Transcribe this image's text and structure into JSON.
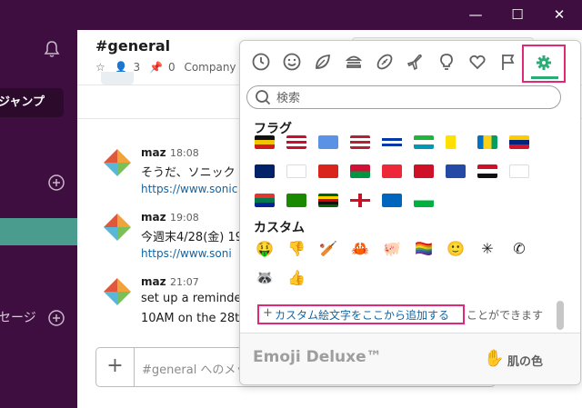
{
  "window": {
    "min_glyph": "—",
    "max_glyph": "☐",
    "close_glyph": "✕"
  },
  "sidebar": {
    "jump_label": "ジャンプ",
    "dm_label": "セージ",
    "icons": [
      "bell-icon",
      "add-channel-icon",
      "add-dm-icon"
    ]
  },
  "channel": {
    "name": "#general",
    "member_count": "3",
    "pin_count": "0",
    "topic_prefix": "Company"
  },
  "messages": [
    {
      "user": "maz",
      "time": "18:08",
      "text": "そうだ、ソニック",
      "link": "https://www.sonic"
    },
    {
      "user": "maz",
      "time": "19:08",
      "text": "今週末4/28(金) 19",
      "link": "https://www.soni"
    },
    {
      "user": "maz",
      "time": "21:07",
      "text": "set up a reminder",
      "text2": "10AM on the 28th"
    }
  ],
  "composer": {
    "plus": "+",
    "placeholder": "#general へのメッ"
  },
  "picker": {
    "tabs": [
      "recent",
      "people",
      "nature",
      "food",
      "activity",
      "travel",
      "objects",
      "symbols",
      "flags",
      "custom"
    ],
    "active_tab": "custom",
    "search_placeholder": "検索",
    "section_flags": "フラグ",
    "section_custom": "カスタム",
    "custom_emojis": [
      "🤑",
      "👎",
      "🏏",
      "🦀",
      "🐖",
      "🏳️‍🌈",
      "🙂",
      "✳",
      "✆",
      "🦝",
      "👍"
    ],
    "hint_plus": "+",
    "hint_link": "カスタム絵文字をここから追加する",
    "hint_rest": "ことができます",
    "preview_name": "Emoji Deluxe™",
    "skin_hand": "✋",
    "skin_label": "肌の色"
  },
  "colors": {
    "sidebar_bg": "#3f0e40",
    "active_channel": "#4a9c8f",
    "link": "#1264a3",
    "highlight_box": "#e0287b",
    "tab_underline": "#2bac76"
  }
}
